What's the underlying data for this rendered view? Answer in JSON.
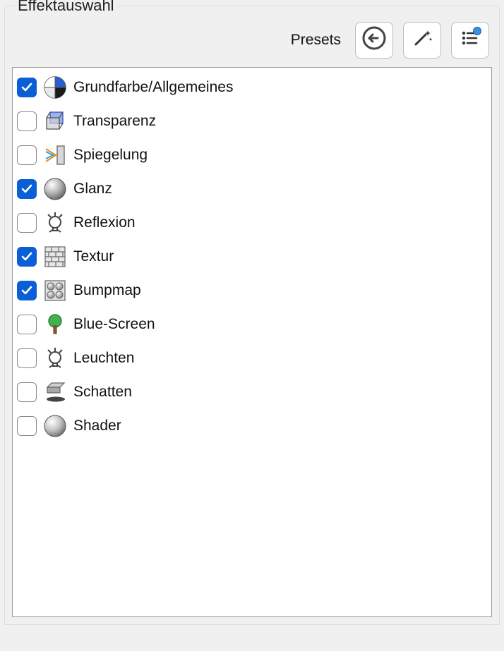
{
  "panel": {
    "title": "Effektauswahl",
    "presets_label": "Presets"
  },
  "icons": {
    "back": "back-icon",
    "wand": "wand-icon",
    "list": "list-icon"
  },
  "effects": [
    {
      "id": "grundfarbe",
      "label": "Grundfarbe/Allgemeines",
      "checked": true,
      "icon": "pie-color-icon"
    },
    {
      "id": "transparenz",
      "label": "Transparenz",
      "checked": false,
      "icon": "cube-transparent-icon"
    },
    {
      "id": "spiegelung",
      "label": "Spiegelung",
      "checked": false,
      "icon": "mirror-icon"
    },
    {
      "id": "glanz",
      "label": "Glanz",
      "checked": true,
      "icon": "sphere-gloss-icon"
    },
    {
      "id": "reflexion",
      "label": "Reflexion",
      "checked": false,
      "icon": "lightbulb-icon"
    },
    {
      "id": "textur",
      "label": "Textur",
      "checked": true,
      "icon": "brick-icon"
    },
    {
      "id": "bumpmap",
      "label": "Bumpmap",
      "checked": true,
      "icon": "four-dots-icon"
    },
    {
      "id": "bluescreen",
      "label": "Blue-Screen",
      "checked": false,
      "icon": "tree-icon"
    },
    {
      "id": "leuchten",
      "label": "Leuchten",
      "checked": false,
      "icon": "lightbulb-icon"
    },
    {
      "id": "schatten",
      "label": "Schatten",
      "checked": false,
      "icon": "shadow-icon"
    },
    {
      "id": "shader",
      "label": "Shader",
      "checked": false,
      "icon": "sphere-plain-icon"
    }
  ]
}
